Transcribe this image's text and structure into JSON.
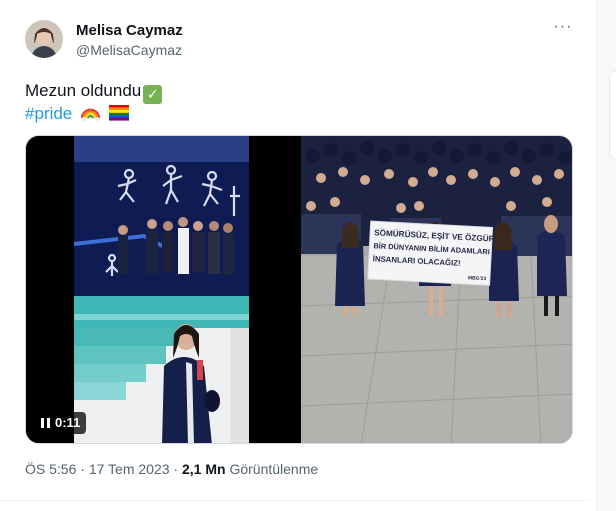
{
  "author": {
    "name": "Melisa Caymaz",
    "handle": "@MelisaCaymaz"
  },
  "menu": {
    "more_label": "···"
  },
  "tweet": {
    "text": "Mezun oldundu",
    "hashtag": "#pride",
    "emojis": [
      "white-check-mark",
      "rainbow",
      "rainbow-flag"
    ]
  },
  "media": {
    "video": {
      "duration": "0:11"
    },
    "photo": {
      "banner_line1": "SÖMÜRÜSÜZ, EŞİT VE ÖZGÜR",
      "banner_line2": "BİR DÜNYANIN BİLİM  ADAMLARI",
      "banner_line3": "İNSANLARI OLACAĞIZ!",
      "banner_tag": "MBG'23"
    }
  },
  "meta": {
    "time": "ÖS 5:56",
    "separator": "·",
    "date": "17 Tem 2023",
    "views_count": "2,1 Mn",
    "views_label": "Görüntülenme"
  },
  "colors": {
    "link": "#1d9bf0",
    "text": "#0f1419",
    "secondary": "#536471"
  }
}
